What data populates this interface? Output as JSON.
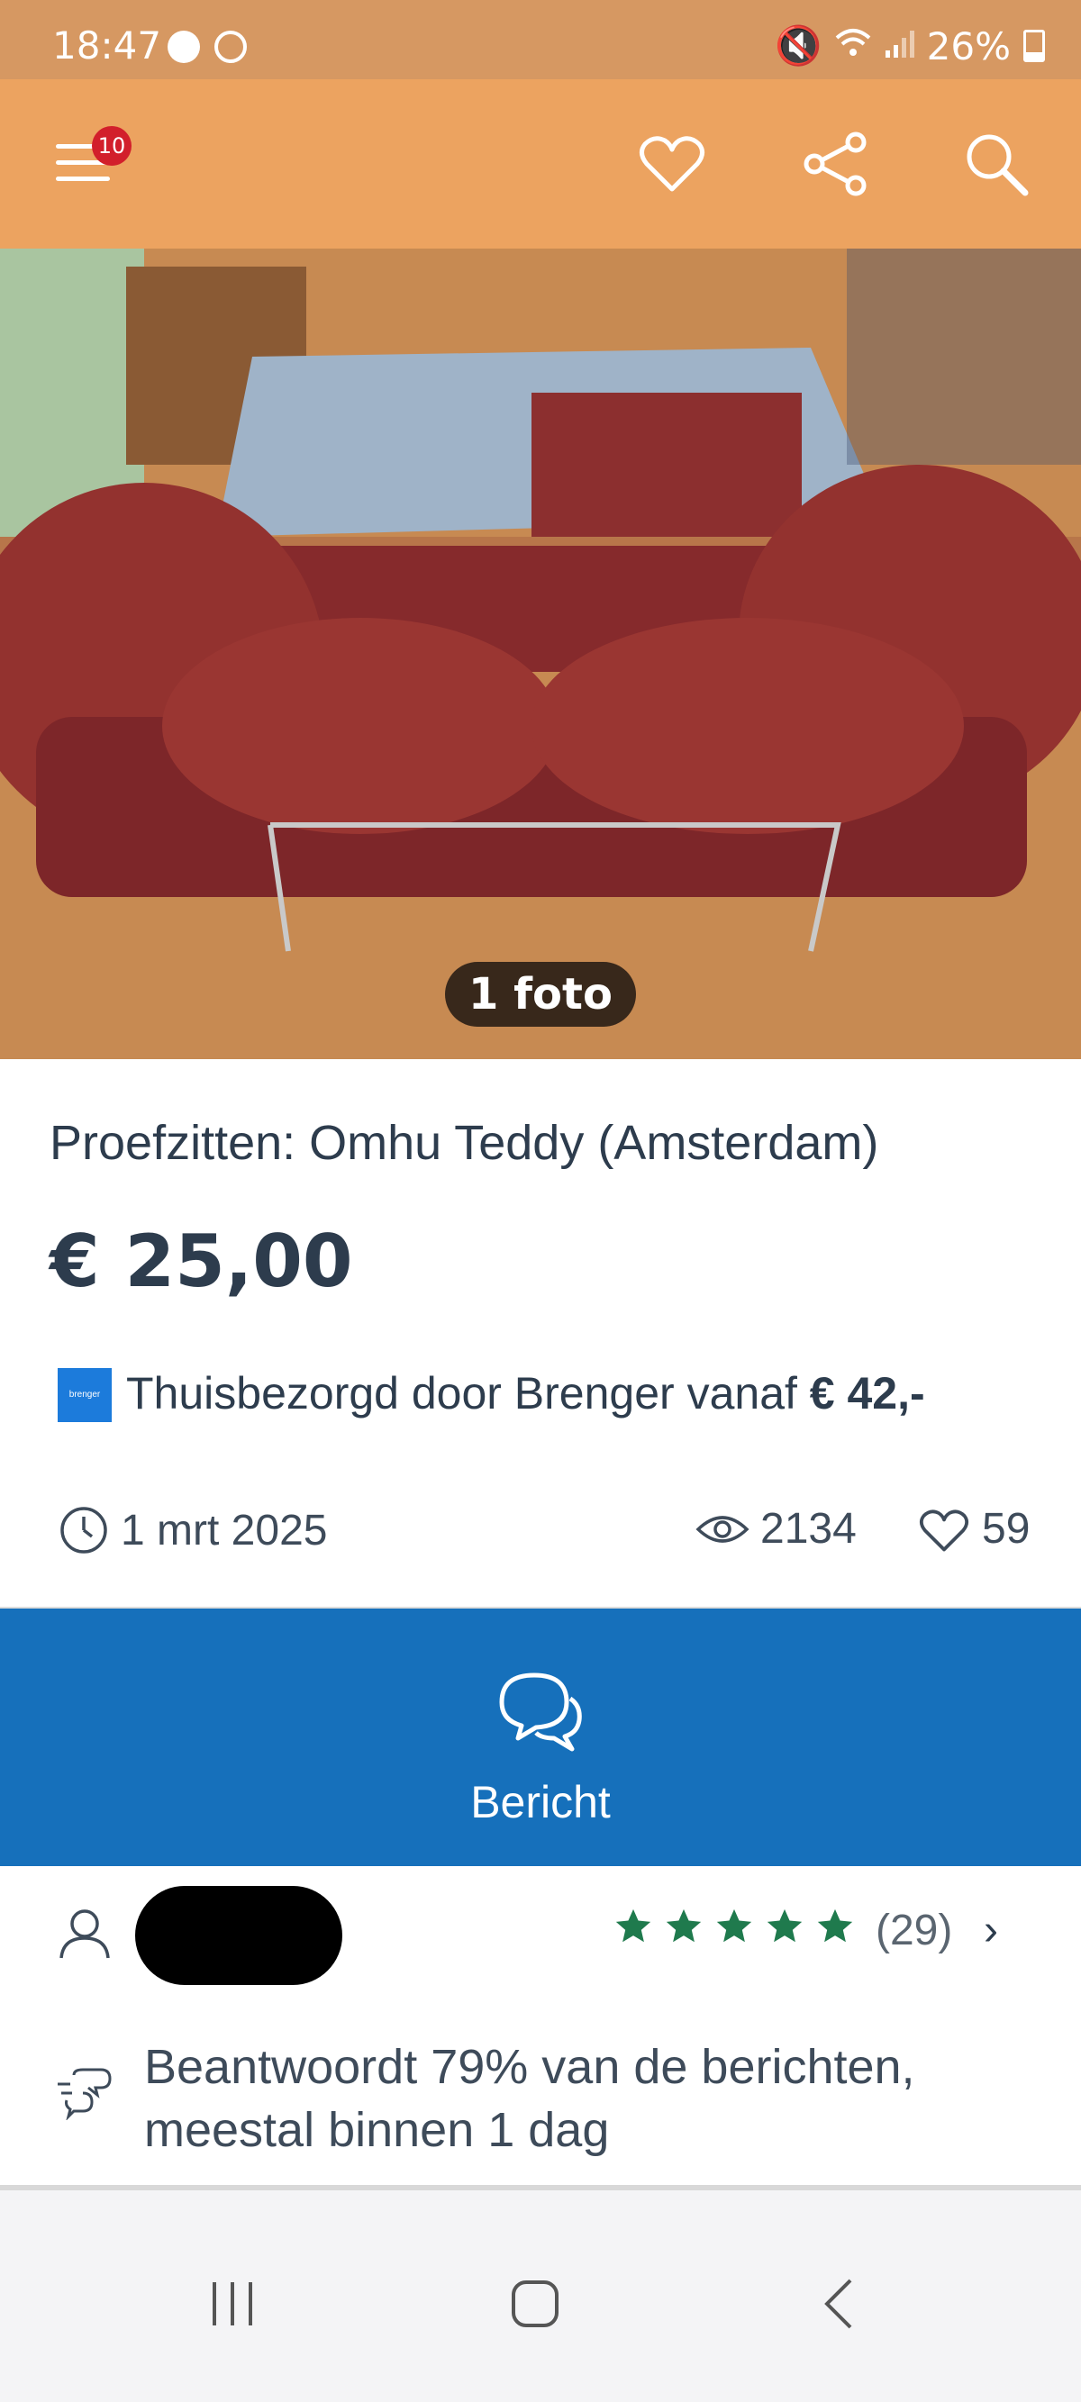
{
  "status_bar": {
    "time": "18:47",
    "battery": "26%"
  },
  "header": {
    "menu_badge": "10",
    "icons": [
      "menu-icon",
      "heart-icon",
      "share-icon",
      "search-icon"
    ]
  },
  "photo": {
    "count_label": "1 foto"
  },
  "listing": {
    "title": "Proefzitten: Omhu Teddy (Amsterdam)",
    "price": "€ 25,00",
    "delivery_logo": "brenger",
    "delivery_text": "Thuisbezorgd door Brenger vanaf ",
    "delivery_price": "€ 42,-",
    "date": "1 mrt 2025",
    "views": "2134",
    "favorites": "59"
  },
  "message_button": {
    "label": "Bericht"
  },
  "seller": {
    "rating_stars": 5,
    "rating_count": "(29)",
    "chevron": "›"
  },
  "response": {
    "text": "Beantwoordt 79% van de berichten, meestal binnen 1 dag"
  },
  "colors": {
    "header": "#eca360",
    "cta": "#1670bb",
    "stars": "#1f7a4d",
    "badge": "#d21f2b"
  }
}
